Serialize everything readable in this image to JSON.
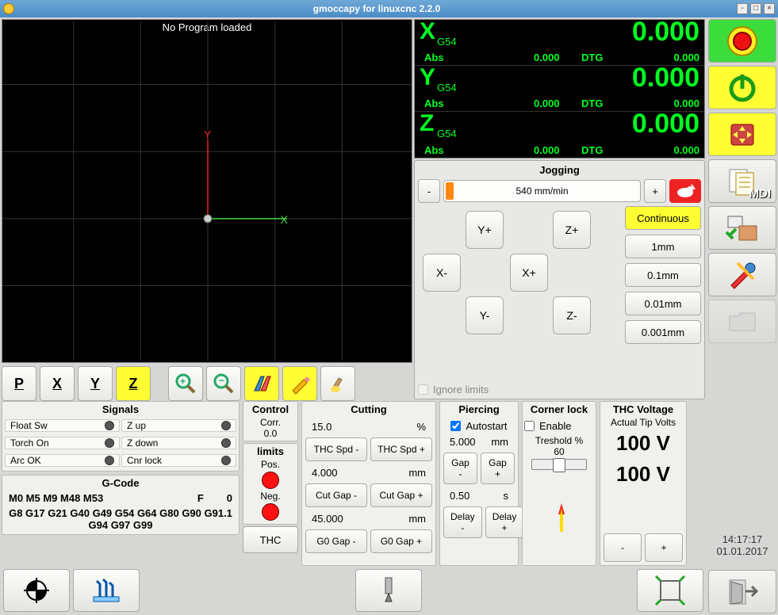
{
  "window": {
    "title": "gmoccapy for linuxcnc  2.2.0"
  },
  "preview": {
    "status": "No Program loaded"
  },
  "dro": {
    "axes": [
      {
        "name": "X",
        "sys": "G54",
        "val": "0.000",
        "abs": "0.000",
        "dtg": "0.000"
      },
      {
        "name": "Y",
        "sys": "G54",
        "val": "0.000",
        "abs": "0.000",
        "dtg": "0.000"
      },
      {
        "name": "Z",
        "sys": "G54",
        "val": "0.000",
        "abs": "0.000",
        "dtg": "0.000"
      }
    ],
    "abs_label": "Abs",
    "dtg_label": "DTG"
  },
  "jog": {
    "title": "Jogging",
    "minus": "-",
    "plus": "+",
    "speed": "540 mm/min",
    "dirs": {
      "yp": "Y+",
      "ym": "Y-",
      "xp": "X+",
      "xm": "X-",
      "zp": "Z+",
      "zm": "Z-"
    },
    "steps": {
      "cont": "Continuous",
      "s1": "1mm",
      "s01": "0.1mm",
      "s001": "0.01mm",
      "s0001": "0.001mm"
    },
    "ignore": "Ignore limits"
  },
  "viewbtns": {
    "p": "P",
    "x": "X",
    "y": "Y",
    "z": "Z"
  },
  "signals": {
    "title": "Signals",
    "left": [
      "Float Sw",
      "Torch On",
      "Arc OK"
    ],
    "right": [
      "Z up",
      "Z down",
      "Cnr lock"
    ]
  },
  "gcode": {
    "title": "G-Code",
    "row1_left": "M0 M5 M9 M48 M53",
    "row1_f": "F",
    "row1_fval": "0",
    "row2": "G8 G17 G21 G40 G49 G54 G64 G80 G90 G91.1 G94 G97 G99"
  },
  "control": {
    "title": "Control",
    "corr": "Corr.",
    "corr_val": "0.0",
    "limits": "limits",
    "pos": "Pos.",
    "neg": "Neg.",
    "thc": "THC"
  },
  "cutting": {
    "title": "Cutting",
    "spd_val": "15.0",
    "spd_unit": "%",
    "spd_minus": "THC Spd -",
    "spd_plus": "THC Spd +",
    "gap_val": "4.000",
    "gap_unit": "mm",
    "gap_minus": "Cut Gap -",
    "gap_plus": "Cut Gap +",
    "g0_val": "45.000",
    "g0_unit": "mm",
    "g0_minus": "G0 Gap -",
    "g0_plus": "G0 Gap +"
  },
  "piercing": {
    "title": "Piercing",
    "autostart": "Autostart",
    "h_val": "5.000",
    "h_unit": "mm",
    "gap_minus": "Gap -",
    "gap_plus": "Gap +",
    "d_val": "0.50",
    "d_unit": "s",
    "delay_minus": "Delay -",
    "delay_plus": "Delay +"
  },
  "corner": {
    "title": "Corner lock",
    "enable": "Enable",
    "treshold": "Treshold %",
    "treshold_val": "60"
  },
  "thc": {
    "title": "THC Voltage",
    "actual": "Actual Tip Volts",
    "v1": "100 V",
    "v2": "100 V",
    "minus": "-",
    "plus": "+"
  },
  "clock": {
    "time": "14:17:17",
    "date": "01.01.2017"
  },
  "sidebar": {
    "mdi": "MDI"
  }
}
